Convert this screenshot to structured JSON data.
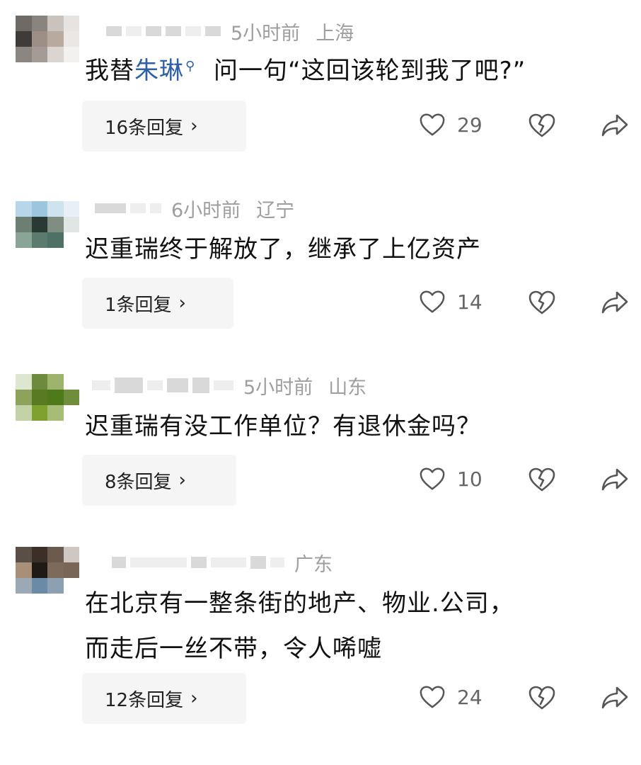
{
  "comments": [
    {
      "time": "5小时前",
      "location": "上海",
      "text_prefix": "我替",
      "mention": "朱琳",
      "mention_icon": "search-icon",
      "text_suffix": " 问一句“这回该轮到我了吧?”",
      "replies": "16条回复",
      "likes": "29"
    },
    {
      "time": "6小时前",
      "location": "辽宁",
      "text": "迟重瑞终于解放了，继承了上亿资产",
      "replies": "1条回复",
      "likes": "14"
    },
    {
      "time": "5小时前",
      "location": "山东",
      "text": "迟重瑞有没工作单位？有退休金吗？",
      "replies": "8条回复",
      "likes": "10"
    },
    {
      "location": "广东",
      "text_line1": "在北京有一整条街的地产、物业.公司，",
      "text_line2": "而走后一丝不带，令人唏嘘",
      "replies": "12条回复",
      "likes": "24"
    }
  ],
  "icons": {
    "like": "heart-icon",
    "dislike": "broken-heart-icon",
    "share": "share-arrow-icon",
    "reply_chevron": "chevron-right-icon"
  },
  "colors": {
    "mention": "#2e5fa8",
    "meta": "#9e9e9e",
    "reply_bg": "#f5f5f5"
  },
  "ui": {
    "chevron": "›"
  }
}
